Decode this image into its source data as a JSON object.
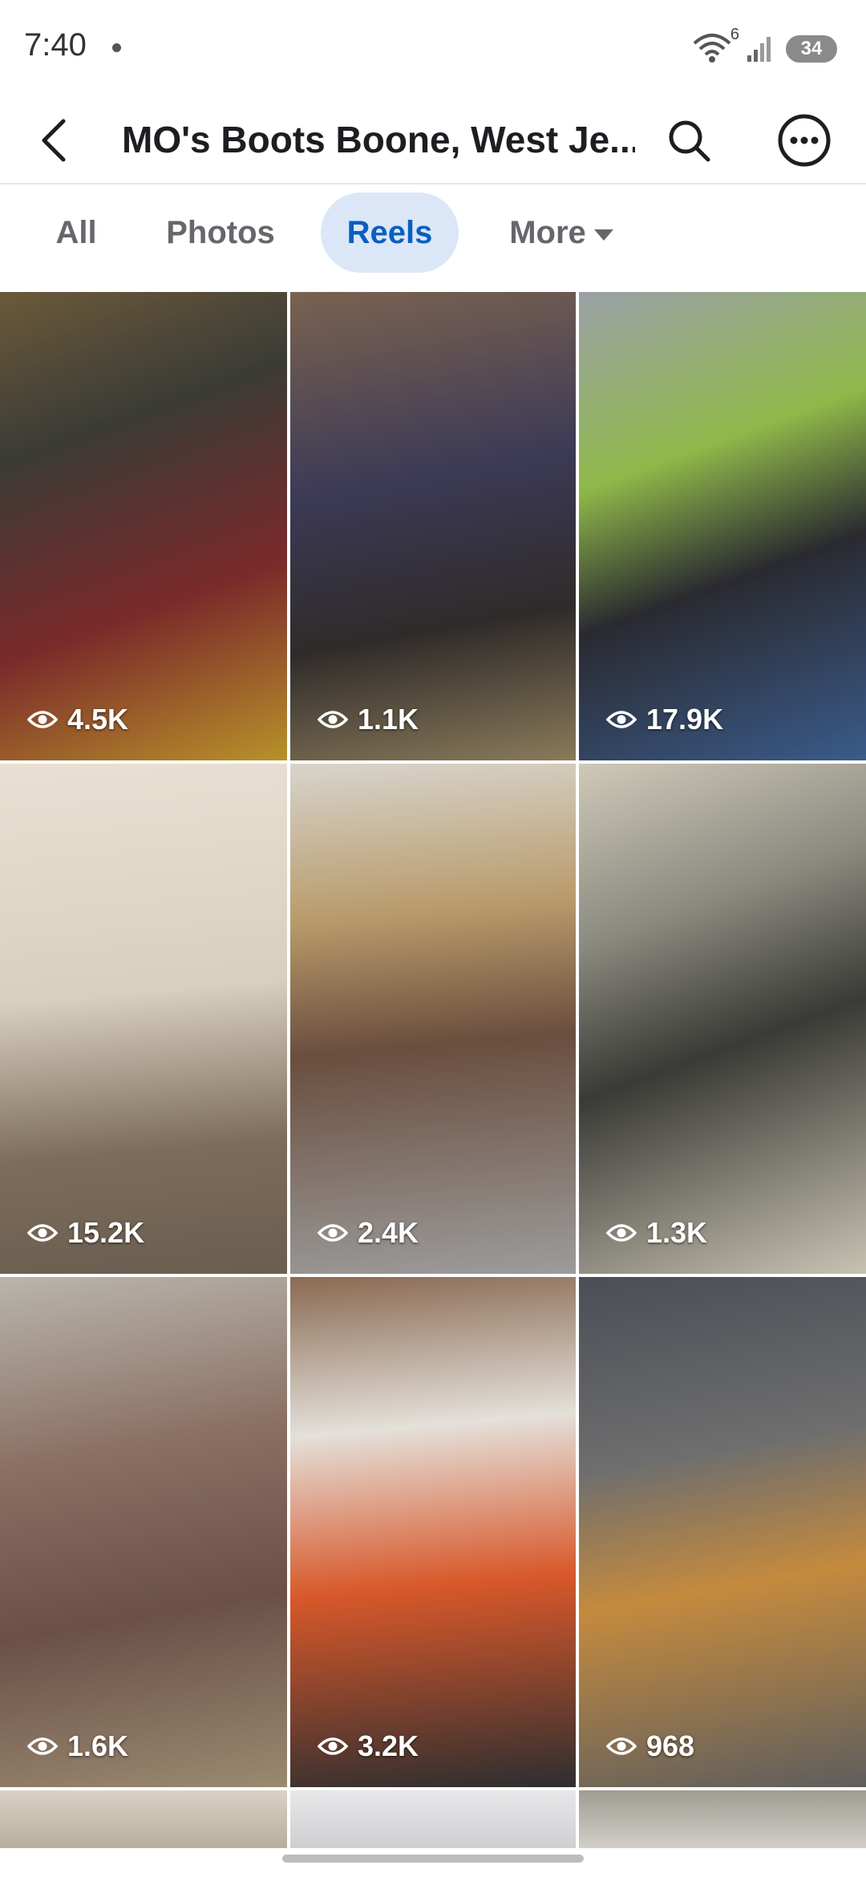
{
  "status_bar": {
    "time": "7:40",
    "wifi_badge": "6",
    "battery": "34",
    "icons": [
      "wifi-icon",
      "signal-icon",
      "battery-icon"
    ]
  },
  "header": {
    "title": "MO's Boots Boone, West Je...",
    "icons": [
      "back-arrow-icon",
      "search-icon",
      "more-options-icon"
    ]
  },
  "tabs": [
    {
      "label": "All",
      "selected": false
    },
    {
      "label": "Photos",
      "selected": false
    },
    {
      "label": "Reels",
      "selected": true
    },
    {
      "label": "More",
      "selected": false
    }
  ],
  "colors": {
    "accent": "#0a5ec2",
    "accent_bg": "#dbe7f7",
    "muted_text": "#65676b"
  },
  "reels": [
    {
      "views": "4.5K"
    },
    {
      "views": "1.1K"
    },
    {
      "views": "17.9K"
    },
    {
      "views": "15.2K"
    },
    {
      "views": "2.4K"
    },
    {
      "views": "1.3K"
    },
    {
      "views": "1.6K"
    },
    {
      "views": "3.2K"
    },
    {
      "views": "968"
    }
  ]
}
